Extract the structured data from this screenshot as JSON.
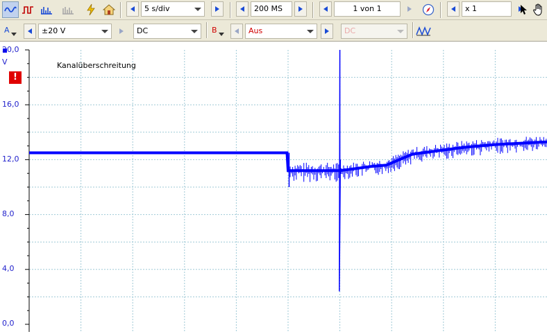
{
  "colors": {
    "trace": "#0000ff",
    "axis_text": "#2222cc",
    "grid": "#9ec9d6",
    "overrange": "#e00000",
    "channel_b": "#d00000"
  },
  "toolbar1": {
    "icons": [
      "scope-mode-icon",
      "persistence-mode-icon",
      "spectrum-mode-icon",
      "spectrum-disabled-icon",
      "signal-generator-icon",
      "home-icon"
    ],
    "timebase": "5 s/div",
    "samples": "200 MS",
    "capture_page": "1 von 1",
    "zoom": "x 1"
  },
  "toolbar2": {
    "channel_a": {
      "label": "A",
      "range": "±20 V",
      "coupling": "DC"
    },
    "channel_b": {
      "label": "B",
      "range": "Aus",
      "coupling": "DC"
    }
  },
  "plot": {
    "overrange_text": "Kanalüberschreitung",
    "overrange_icon": "!",
    "y_unit": "V",
    "y_ticks": [
      "20,0",
      "16,0",
      "12,0",
      "8,0",
      "4,0",
      "0,0"
    ]
  },
  "chart_data": {
    "type": "line",
    "ylim": [
      0,
      20
    ],
    "xlim": [
      0,
      50
    ],
    "grid": true,
    "series": [
      {
        "x": [
          0,
          5,
          10,
          15,
          20,
          24.9,
          25.0,
          25.1,
          27,
          30,
          31,
          33,
          34.5,
          37,
          40,
          42,
          45,
          50
        ],
        "y": [
          12.5,
          12.5,
          12.5,
          12.5,
          12.5,
          12.5,
          11.2,
          11.2,
          11.2,
          11.2,
          11.3,
          11.5,
          11.6,
          12.4,
          12.7,
          12.9,
          13.1,
          13.3
        ]
      }
    ]
  }
}
